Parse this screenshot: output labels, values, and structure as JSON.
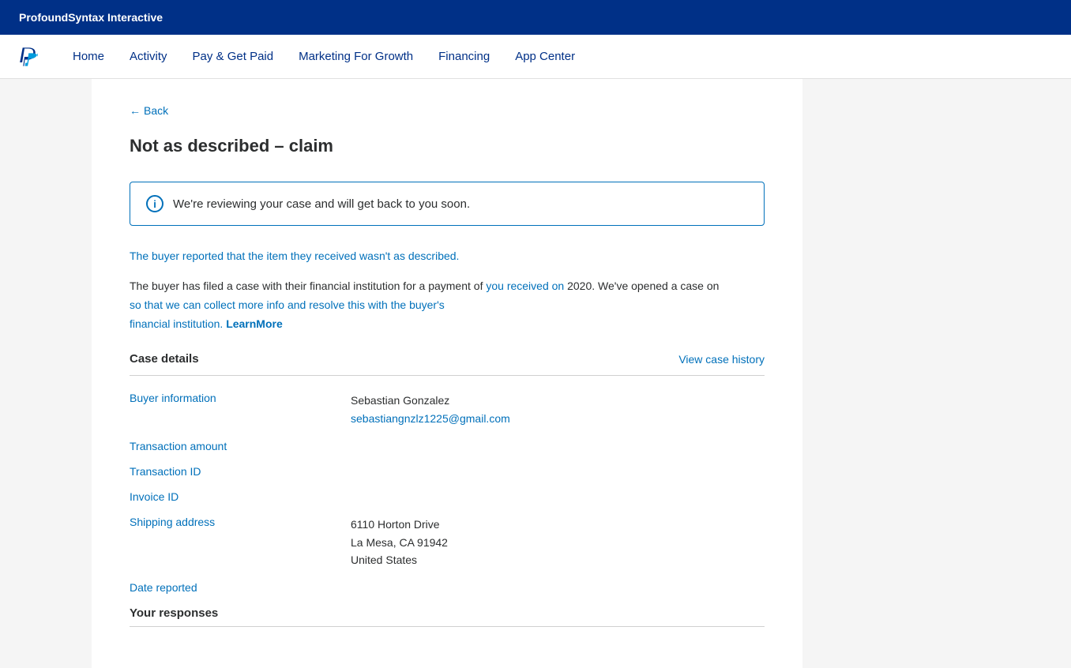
{
  "topBanner": {
    "title": "ProfoundSyntax Interactive"
  },
  "navbar": {
    "logoAlt": "PayPal",
    "links": [
      {
        "id": "home",
        "label": "Home"
      },
      {
        "id": "activity",
        "label": "Activity"
      },
      {
        "id": "pay-get-paid",
        "label": "Pay & Get Paid"
      },
      {
        "id": "marketing",
        "label": "Marketing For Growth"
      },
      {
        "id": "financing",
        "label": "Financing"
      },
      {
        "id": "app-center",
        "label": "App Center"
      }
    ]
  },
  "backLink": "Back",
  "pageTitle": "Not as described – claim",
  "infoBanner": {
    "text": "We're reviewing your case and will get back to you soon."
  },
  "descriptionLine1": "The buyer reported that the item they received wasn't as described.",
  "descriptionLine2Part1": "The buyer has filed a case with their financial institution for a payment of",
  "descriptionLine2Part2": "you received on",
  "descriptionLine2Part3": "2020. We've opened a case on",
  "descriptionLine2Part4": "so that we can collect more info and resolve this with the buyer's",
  "descriptionLine2Part5": "financial institution.",
  "learnMoreLabel": "LearnMore",
  "caseDetails": {
    "sectionTitle": "Case details",
    "viewHistoryLabel": "View case history",
    "rows": [
      {
        "label": "Buyer information",
        "valueName": "Sebastian Gonzalez",
        "valueEmail": "sebastiangnzlz1225@gmail.com"
      },
      {
        "label": "Transaction amount",
        "value": ""
      },
      {
        "label": "Transaction ID",
        "value": ""
      },
      {
        "label": "Invoice ID",
        "value": ""
      },
      {
        "label": "Shipping address",
        "valueLine1": "6110 Horton Drive",
        "valueLine2": "La Mesa, CA 91942",
        "valueLine3": "United States"
      },
      {
        "label": "Date reported",
        "value": ""
      }
    ]
  },
  "yourResponses": {
    "sectionTitle": "Your responses"
  }
}
